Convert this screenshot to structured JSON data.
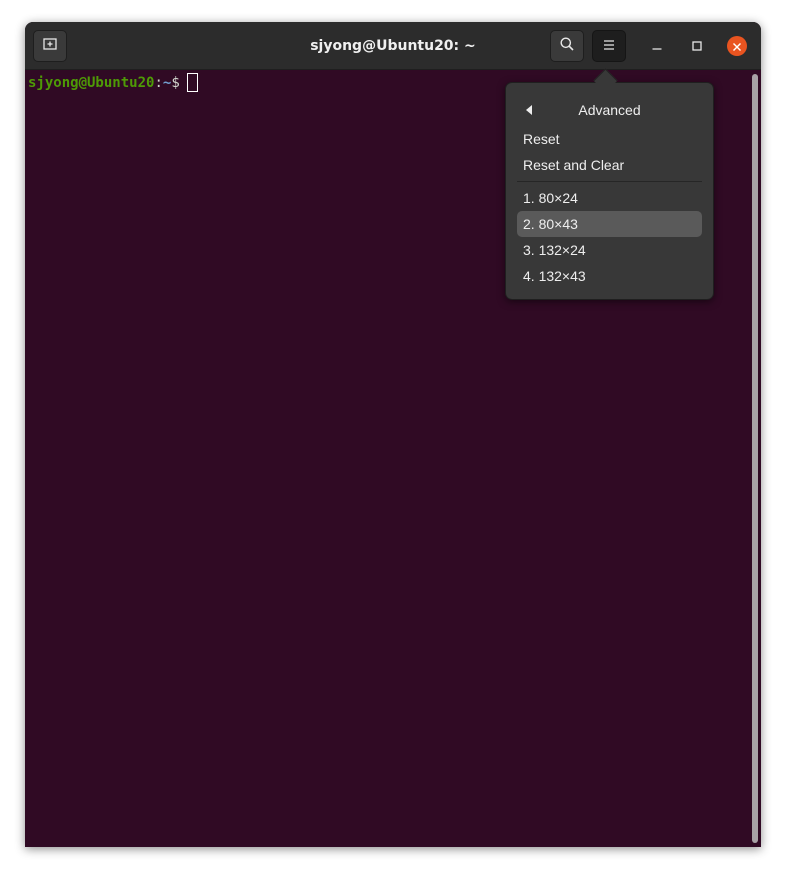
{
  "window": {
    "title": "sjyong@Ubuntu20: ~"
  },
  "titlebar": {
    "new_tab_icon": "new-tab-icon",
    "search_icon": "search-icon",
    "menu_icon": "hamburger-menu-icon",
    "minimize_icon": "minimize-icon",
    "maximize_icon": "maximize-icon",
    "close_icon": "close-icon"
  },
  "terminal": {
    "prompt_user": "sjyong@Ubuntu20",
    "prompt_sep": ":",
    "prompt_path": "~",
    "prompt_dollar": "$"
  },
  "menu": {
    "header": "Advanced",
    "items": [
      {
        "label": "Reset"
      },
      {
        "label": "Reset and Clear"
      }
    ],
    "sizes": [
      {
        "label": "1. 80×24",
        "selected": false
      },
      {
        "label": "2. 80×43",
        "selected": true
      },
      {
        "label": "3. 132×24",
        "selected": false
      },
      {
        "label": "4. 132×43",
        "selected": false
      }
    ]
  },
  "colors": {
    "terminal_bg": "#300a24",
    "prompt_user": "#4e9a06",
    "prompt_path": "#729fcf",
    "close_button": "#e95420"
  }
}
